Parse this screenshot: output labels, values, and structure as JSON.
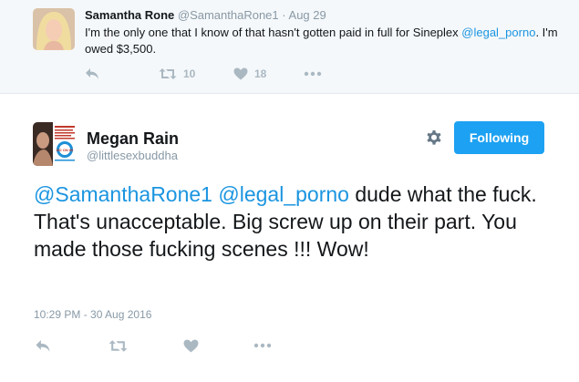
{
  "parent": {
    "name": "Samantha Rone",
    "handle": "@SamanthaRone1",
    "separator": "·",
    "date": "Aug 29",
    "text_pre": "I'm the only one that I know of that hasn't gotten paid in full for Sineplex ",
    "text_mention": "@legal_porno",
    "text_post": ". I'm owed $3,500.",
    "retweets": "10",
    "likes": "18"
  },
  "main": {
    "name": "Megan Rain",
    "handle": "@littlesexbuddha",
    "follow_label": "Following",
    "mention1": "@SamanthaRone1",
    "mention2": "@legal_porno",
    "text_body": " dude what the fuck. That's unacceptable. Big screw up on their part. You made those fucking scenes !!! Wow!",
    "timestamp": "10:29 PM - 30 Aug 2016",
    "avatar_badge": "NO ON 60"
  },
  "colors": {
    "link": "#1b95e0",
    "button": "#1da1f2",
    "muted": "#8899a6",
    "icon": "#aab8c2",
    "parent_bg": "#f5f8fa"
  },
  "icons": {
    "reply": "reply-icon",
    "retweet": "retweet-icon",
    "like": "heart-icon",
    "more": "more-icon",
    "settings": "gear-icon"
  }
}
